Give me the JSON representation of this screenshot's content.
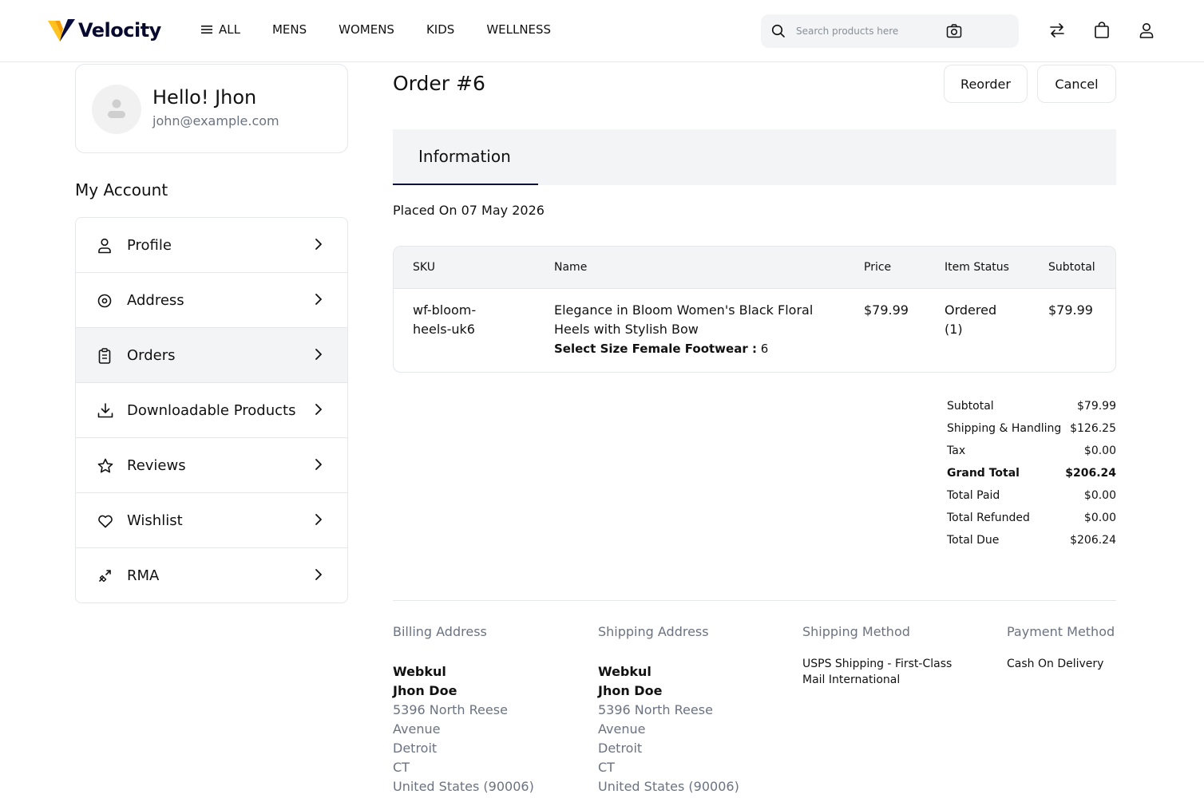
{
  "header": {
    "brand": "Velocity",
    "nav": [
      "ALL",
      "MENS",
      "WOMENS",
      "KIDS",
      "WELLNESS"
    ],
    "search_placeholder": "Search products here",
    "icons": [
      "compare-icon",
      "cart-icon",
      "user-icon"
    ]
  },
  "profile": {
    "greeting": "Hello! Jhon",
    "email": "john@example.com"
  },
  "sidebar": {
    "title": "My Account",
    "items": [
      {
        "label": "Profile",
        "icon": "user-icon"
      },
      {
        "label": "Address",
        "icon": "location-icon"
      },
      {
        "label": "Orders",
        "icon": "clipboard-icon",
        "active": true
      },
      {
        "label": "Downloadable Products",
        "icon": "download-icon"
      },
      {
        "label": "Reviews",
        "icon": "star-icon"
      },
      {
        "label": "Wishlist",
        "icon": "heart-icon"
      },
      {
        "label": "RMA",
        "icon": "rma-icon"
      }
    ]
  },
  "order": {
    "title": "Order #6",
    "reorder_label": "Reorder",
    "cancel_label": "Cancel",
    "tab": "Information",
    "placed_on": "Placed On 07 May 2026",
    "table": {
      "headers": [
        "SKU",
        "Name",
        "Price",
        "Item Status",
        "Subtotal"
      ],
      "row": {
        "sku_line1": "wf-bloom-",
        "sku_line2": "heels-uk6",
        "name_line1": "Elegance in Bloom Women's Black Floral",
        "name_line2": "Heels with Stylish Bow",
        "option_label": "Select Size Female Footwear :",
        "option_value": " 6",
        "price": "$79.99",
        "status_line1": "Ordered",
        "status_line2": "(1)",
        "subtotal": "$79.99"
      }
    },
    "totals": [
      {
        "label": "Subtotal",
        "value": "$79.99"
      },
      {
        "label": "Shipping & Handling",
        "value": "$126.25"
      },
      {
        "label": "Tax",
        "value": "$0.00"
      },
      {
        "label": "Grand Total",
        "value": "$206.24",
        "bold": true
      },
      {
        "label": "Total Paid",
        "value": "$0.00"
      },
      {
        "label": "Total Refunded",
        "value": "$0.00"
      },
      {
        "label": "Total Due",
        "value": "$206.24"
      }
    ],
    "billing": {
      "heading": "Billing Address",
      "company": "Webkul",
      "name": "Jhon Doe",
      "street1": "5396 North Reese",
      "street2": "Avenue",
      "city": "Detroit",
      "state": "CT",
      "country": "United States (90006)"
    },
    "shipping": {
      "heading": "Shipping Address",
      "company": "Webkul",
      "name": "Jhon Doe",
      "street1": "5396 North Reese",
      "street2": "Avenue",
      "city": "Detroit",
      "state": "CT",
      "country": "United States (90006)"
    },
    "shipping_method": {
      "heading": "Shipping Method",
      "line1": "USPS Shipping - First-Class",
      "line2": "Mail International"
    },
    "payment_method": {
      "heading": "Payment Method",
      "value": "Cash On Delivery"
    }
  },
  "colors": {
    "brand_dark": "#060c3b",
    "logo_yellow": "#ffc21f",
    "border": "#e5e7eb",
    "panel": "#f3f4f6",
    "muted": "#6b7280"
  }
}
